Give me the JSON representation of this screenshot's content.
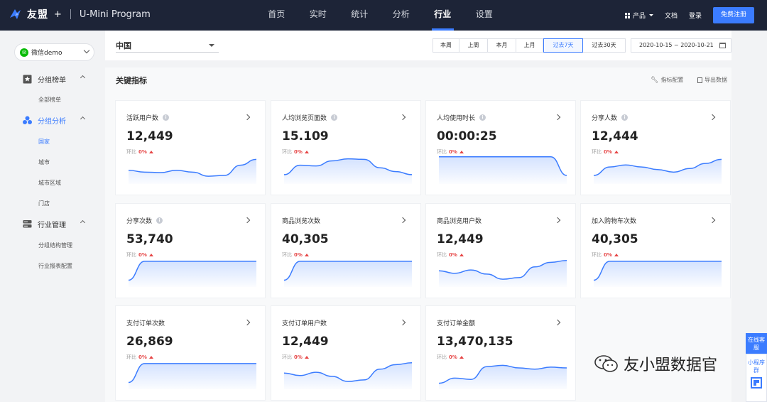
{
  "header": {
    "brand_name": "友盟",
    "brand_plus": "+",
    "product": "U-Mini Program",
    "nav": [
      {
        "label": "首页",
        "active": false
      },
      {
        "label": "实时",
        "active": false
      },
      {
        "label": "统计",
        "active": false
      },
      {
        "label": "分析",
        "active": false
      },
      {
        "label": "行业",
        "active": true
      },
      {
        "label": "设置",
        "active": false
      }
    ],
    "products_label": "产品",
    "docs_label": "文档",
    "login_label": "登录",
    "register_label": "免费注册"
  },
  "sidebar": {
    "app_name": "微信demo",
    "groups": [
      {
        "label": "分组榜单",
        "icon": "star-board-icon",
        "active": false,
        "items": [
          {
            "label": "全部榜单",
            "active": false
          }
        ]
      },
      {
        "label": "分组分析",
        "icon": "group-people-icon",
        "active": true,
        "items": [
          {
            "label": "国家",
            "active": true
          },
          {
            "label": "城市",
            "active": false
          },
          {
            "label": "城市区域",
            "active": false
          },
          {
            "label": "门店",
            "active": false
          }
        ]
      },
      {
        "label": "行业管理",
        "icon": "server-stack-icon",
        "active": false,
        "items": [
          {
            "label": "分组结构管理",
            "active": false
          },
          {
            "label": "行业报表配置",
            "active": false
          }
        ]
      }
    ]
  },
  "filter": {
    "country": "中国",
    "ranges": [
      {
        "label": "本周",
        "active": false
      },
      {
        "label": "上周",
        "active": false
      },
      {
        "label": "本月",
        "active": false
      },
      {
        "label": "上月",
        "active": false
      },
      {
        "label": "过去7天",
        "active": true
      },
      {
        "label": "过去30天",
        "active": false
      }
    ],
    "date_range": "2020-10-15 ~ 2020-10-21"
  },
  "panel": {
    "title": "关键指标",
    "config_label": "指标配置",
    "export_label": "导出数据"
  },
  "compare_label": "环比",
  "metrics": [
    {
      "title": "活跃用户数",
      "info": true,
      "value": "12,449",
      "change": "0%",
      "trend": "wave-dip"
    },
    {
      "title": "人均浏览页面数",
      "info": true,
      "value": "15.109",
      "change": "0%",
      "trend": "hill"
    },
    {
      "title": "人均使用时长",
      "info": true,
      "value": "00:00:25",
      "change": "0%",
      "trend": "plateau-drop"
    },
    {
      "title": "分享人数",
      "info": true,
      "value": "12,444",
      "change": "0%",
      "trend": "wave-rise"
    },
    {
      "title": "分享次数",
      "info": true,
      "value": "53,740",
      "change": "0%",
      "trend": "rise-flat"
    },
    {
      "title": "商品浏览次数",
      "info": false,
      "value": "40,305",
      "change": "0%",
      "trend": "rise-flat"
    },
    {
      "title": "商品浏览用户数",
      "info": false,
      "value": "12,449",
      "change": "0%",
      "trend": "dip-rise"
    },
    {
      "title": "加入购物车次数",
      "info": false,
      "value": "40,305",
      "change": "0%",
      "trend": "rise-flat"
    },
    {
      "title": "支付订单次数",
      "info": false,
      "value": "26,869",
      "change": "0%",
      "trend": "rise-flat"
    },
    {
      "title": "支付订单用户数",
      "info": false,
      "value": "12,449",
      "change": "0%",
      "trend": "dip-rise"
    },
    {
      "title": "支付订单金额",
      "info": false,
      "value": "13,470,135",
      "change": "0%",
      "trend": "bump-rise"
    }
  ],
  "float": {
    "online_service": "在线客服",
    "mini_group": "小程序群"
  },
  "watermark": "友小盟数据官",
  "colors": {
    "accent": "#3b7cff",
    "topbar": "#1d2437",
    "up": "#e64545"
  }
}
